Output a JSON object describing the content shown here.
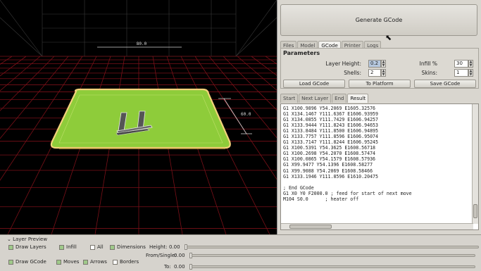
{
  "viewport": {
    "dim_width": "80.0",
    "dim_depth": "60.0",
    "colors": {
      "bed": "#8ecc3a",
      "bed_border": "#f2d27a",
      "grid": "#7a1018",
      "background": "#000000"
    }
  },
  "right_panel": {
    "generate_label": "Generate GCode",
    "main_tabs": [
      "Files",
      "Model",
      "GCode",
      "Printer",
      "Logs"
    ],
    "active_main_tab": "GCode",
    "parameters": {
      "title": "Parameters",
      "layer_height_label": "Layer Height:",
      "layer_height_value": "0.2",
      "infill_label": "Infill %",
      "infill_value": "30",
      "shells_label": "Shells:",
      "shells_value": "2",
      "skins_label": "Skins:",
      "skins_value": "1",
      "load_label": "Load GCode",
      "to_platform_label": "To Platform",
      "save_label": "Save GCode"
    },
    "sub_tabs": [
      "Start",
      "Next Layer",
      "End",
      "Result"
    ],
    "active_sub_tab": "Result",
    "gcode_lines": [
      "G1 X100.9896 Y54.2069 E1605.32576",
      "G1 X134.1467 Y111.6367 E1606.93959",
      "G1 X134.0855 Y111.7429 E1606.94257",
      "G1 X133.9444 Y111.8243 E1606.94653",
      "G1 X133.8484 Y111.8500 E1606.94895",
      "G1 X133.7757 Y111.8596 E1606.95074",
      "G1 X133.7147 Y111.8244 E1606.95245",
      "G1 X100.5391 Y54.3625 E1608.56718",
      "G1 X100.2698 Y54.2070 E1608.57474",
      "G1 X100.0865 Y54.1579 E1608.57936",
      "G1 X99.9477 Y54.1396 E1608.58277",
      "G1 X99.9088 Y54.2069 E1608.58466",
      "G1 X133.1946 Y111.8596 E1610.20475",
      "",
      "; End GCode",
      "G1 X0 Y0 F2000.0 ; feed for start of next move",
      "M104 S0.0      ; heater off"
    ]
  },
  "layer_preview": {
    "title": "Layer Preview",
    "draw_layers": "Draw Layers",
    "infill": "Infill",
    "all": "All",
    "dimensions": "Dimensions",
    "height_label": "Height:",
    "height_value": "0.00",
    "draw_gcode": "Draw GCode",
    "moves": "Moves",
    "arrows": "Arrows",
    "borders": "Borders",
    "from_label": "From/Single:",
    "from_value": "0.00",
    "to_label": "To:",
    "to_value": "0.00"
  }
}
